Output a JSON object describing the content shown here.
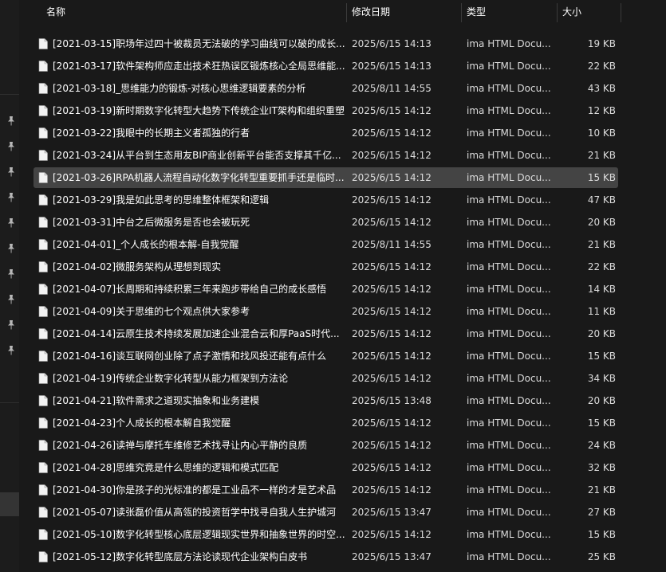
{
  "columns": {
    "name": "名称",
    "date": "修改日期",
    "type": "类型",
    "size": "大小"
  },
  "rows": [
    {
      "name": "[2021-03-15]职场年过四十被裁员无法破的学习曲线可以破的成长...",
      "date": "2025/6/15 14:13",
      "type": "ima HTML Docu...",
      "size": "19 KB"
    },
    {
      "name": "[2021-03-17]软件架构师应走出技术狂热误区锻炼核心全局思维能...",
      "date": "2025/6/15 14:13",
      "type": "ima HTML Docu...",
      "size": "22 KB"
    },
    {
      "name": "[2021-03-18]_思维能力的锻炼-对核心思维逻辑要素的分析",
      "date": "2025/8/11 14:55",
      "type": "ima HTML Docu...",
      "size": "43 KB"
    },
    {
      "name": "[2021-03-19]新时期数字化转型大趋势下传统企业IT架构和组织重塑",
      "date": "2025/6/15 14:12",
      "type": "ima HTML Docu...",
      "size": "12 KB"
    },
    {
      "name": "[2021-03-22]我眼中的长期主义者孤独的行者",
      "date": "2025/6/15 14:12",
      "type": "ima HTML Docu...",
      "size": "10 KB"
    },
    {
      "name": "[2021-03-24]从平台到生态用友BIP商业创新平台能否支撑其千亿...",
      "date": "2025/6/15 14:12",
      "type": "ima HTML Docu...",
      "size": "21 KB"
    },
    {
      "name": "[2021-03-26]RPA机器人流程自动化数字化转型重要抓手还是临时...",
      "date": "2025/6/15 14:12",
      "type": "ima HTML Docu...",
      "size": "15 KB",
      "selected": true
    },
    {
      "name": "[2021-03-29]我是如此思考的思维整体框架和逻辑",
      "date": "2025/6/15 14:12",
      "type": "ima HTML Docu...",
      "size": "47 KB"
    },
    {
      "name": "[2021-03-31]中台之后微服务是否也会被玩死",
      "date": "2025/6/15 14:12",
      "type": "ima HTML Docu...",
      "size": "20 KB"
    },
    {
      "name": "[2021-04-01]_个人成长的根本解-自我觉醒",
      "date": "2025/8/11 14:55",
      "type": "ima HTML Docu...",
      "size": "21 KB"
    },
    {
      "name": "[2021-04-02]微服务架构从理想到现实",
      "date": "2025/6/15 14:12",
      "type": "ima HTML Docu...",
      "size": "22 KB"
    },
    {
      "name": "[2021-04-07]长周期和持续积累三年来跑步带给自己的成长感悟",
      "date": "2025/6/15 14:12",
      "type": "ima HTML Docu...",
      "size": "14 KB"
    },
    {
      "name": "[2021-04-09]关于思维的七个观点供大家参考",
      "date": "2025/6/15 14:12",
      "type": "ima HTML Docu...",
      "size": "11 KB"
    },
    {
      "name": "[2021-04-14]云原生技术持续发展加速企业混合云和厚PaaS时代...",
      "date": "2025/6/15 14:12",
      "type": "ima HTML Docu...",
      "size": "20 KB"
    },
    {
      "name": "[2021-04-16]谈互联网创业除了点子激情和找风投还能有点什么",
      "date": "2025/6/15 14:12",
      "type": "ima HTML Docu...",
      "size": "15 KB"
    },
    {
      "name": "[2021-04-19]传统企业数字化转型从能力框架到方法论",
      "date": "2025/6/15 14:12",
      "type": "ima HTML Docu...",
      "size": "34 KB"
    },
    {
      "name": "[2021-04-21]软件需求之道现实抽象和业务建模",
      "date": "2025/6/15 13:48",
      "type": "ima HTML Docu...",
      "size": "20 KB"
    },
    {
      "name": "[2021-04-23]个人成长的根本解自我觉醒",
      "date": "2025/6/15 14:12",
      "type": "ima HTML Docu...",
      "size": "15 KB"
    },
    {
      "name": "[2021-04-26]读禅与摩托车维修艺术找寻让内心平静的良质",
      "date": "2025/6/15 14:12",
      "type": "ima HTML Docu...",
      "size": "24 KB"
    },
    {
      "name": "[2021-04-28]思维究竟是什么思维的逻辑和模式匹配",
      "date": "2025/6/15 14:12",
      "type": "ima HTML Docu...",
      "size": "32 KB"
    },
    {
      "name": "[2021-04-30]你是孩子的光标准的都是工业品不一样的才是艺术品",
      "date": "2025/6/15 14:12",
      "type": "ima HTML Docu...",
      "size": "21 KB"
    },
    {
      "name": "[2021-05-07]读张磊价值从高瓴的投资哲学中找寻自我人生护城河",
      "date": "2025/6/15 13:47",
      "type": "ima HTML Docu...",
      "size": "27 KB"
    },
    {
      "name": "[2021-05-10]数字化转型核心底层逻辑现实世界和抽象世界的时空...",
      "date": "2025/6/15 14:12",
      "type": "ima HTML Docu...",
      "size": "15 KB"
    },
    {
      "name": "[2021-05-12]数字化转型底层方法论读现代企业架构白皮书",
      "date": "2025/6/15 13:47",
      "type": "ima HTML Docu...",
      "size": "25 KB"
    }
  ]
}
